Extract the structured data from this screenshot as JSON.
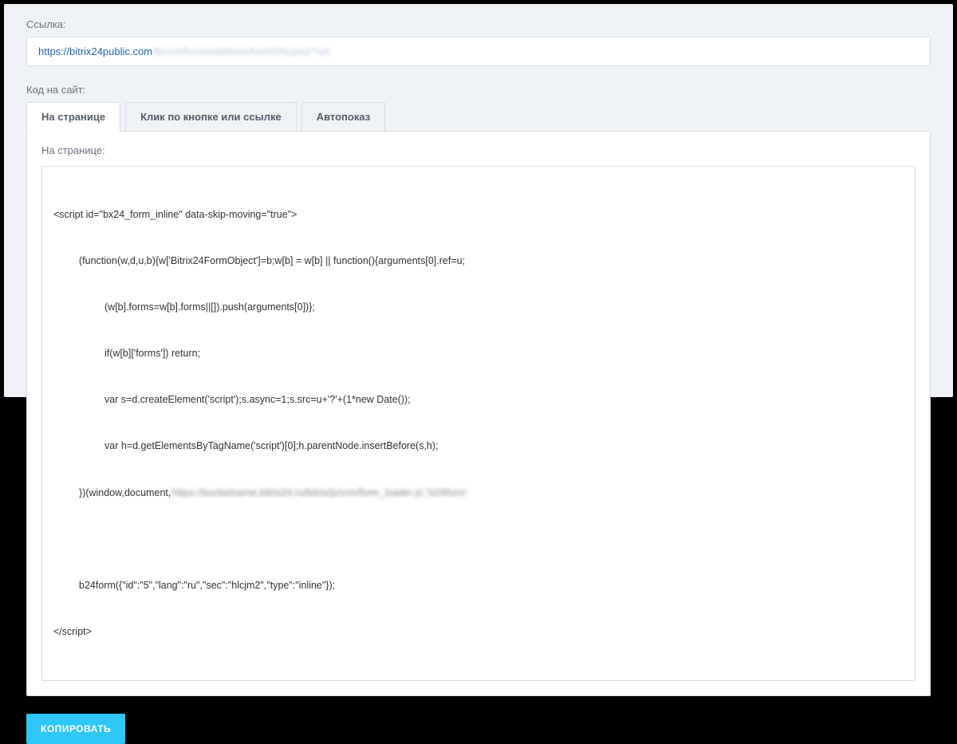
{
  "link": {
    "label": "Ссылка:",
    "visible": "https://bitrix24public.com",
    "blurred": "/b/crm/form/webform/form5/hlcjm2/?url"
  },
  "codeSite": {
    "label": "Код на сайт:"
  },
  "tabs": [
    {
      "label": "На странице",
      "active": true
    },
    {
      "label": "Клик по кнопке или ссылке",
      "active": false
    },
    {
      "label": "Автопоказ",
      "active": false
    }
  ],
  "codeBlock": {
    "sublabel": "На странице:",
    "lines": {
      "l1": "<script id=\"bx24_form_inline\" data-skip-moving=\"true\">",
      "l2": "(function(w,d,u,b){w['Bitrix24FormObject']=b;w[b] = w[b] || function(){arguments[0].ref=u;",
      "l3": "(w[b].forms=w[b].forms||[]).push(arguments[0])};",
      "l4": "if(w[b]['forms']) return;",
      "l5": "var s=d.createElement('script');s.async=1;s.src=u+'?'+(1*new Date());",
      "l6": "var h=d.getElementsByTagName('script')[0];h.parentNode.insertBefore(s,h);",
      "l7a": "})(window,document,",
      "l7b": "'https://bucketname.bitrix24.ru/bitrix/js/crm/form_loader.js','b24form'",
      "l8": " ",
      "l9": "b24form({\"id\":\"5\",\"lang\":\"ru\",\"sec\":\"hlcjm2\",\"type\":\"inline\"});",
      "l10": "</script>"
    }
  },
  "copy": {
    "label": "КОПИРОВАТЬ"
  }
}
